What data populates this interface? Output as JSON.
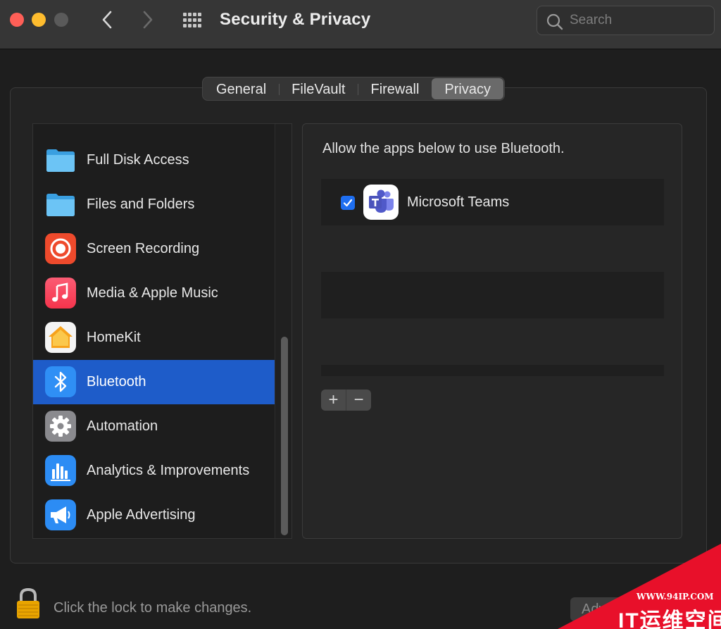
{
  "window": {
    "title": "Security & Privacy",
    "search_placeholder": "Search"
  },
  "tabs": [
    {
      "label": "General",
      "active": false
    },
    {
      "label": "FileVault",
      "active": false
    },
    {
      "label": "Firewall",
      "active": false
    },
    {
      "label": "Privacy",
      "active": true
    }
  ],
  "sidebar": {
    "items": [
      {
        "label": "Full Disk Access",
        "icon": "folder-icon",
        "selected": false
      },
      {
        "label": "Files and Folders",
        "icon": "folder-icon",
        "selected": false
      },
      {
        "label": "Screen Recording",
        "icon": "record-icon",
        "selected": false
      },
      {
        "label": "Media & Apple Music",
        "icon": "music-note-icon",
        "selected": false
      },
      {
        "label": "HomeKit",
        "icon": "home-icon",
        "selected": false
      },
      {
        "label": "Bluetooth",
        "icon": "bluetooth-icon",
        "selected": true
      },
      {
        "label": "Automation",
        "icon": "gear-icon",
        "selected": false
      },
      {
        "label": "Analytics & Improvements",
        "icon": "bar-chart-icon",
        "selected": false
      },
      {
        "label": "Apple Advertising",
        "icon": "megaphone-icon",
        "selected": false
      }
    ]
  },
  "main": {
    "description": "Allow the apps below to use Bluetooth.",
    "apps": [
      {
        "name": "Microsoft Teams",
        "checked": true,
        "icon": "teams-icon"
      }
    ],
    "add_label": "+",
    "remove_label": "−"
  },
  "footer": {
    "lock_text": "Click the lock to make changes.",
    "advanced_label": "Advanced..."
  },
  "watermark": {
    "url": "WWW.94IP.COM",
    "brand": "IT运维空间"
  },
  "colors": {
    "selection": "#1e5cc9",
    "checkbox": "#1e6ef0",
    "watermark": "#e8102a"
  }
}
